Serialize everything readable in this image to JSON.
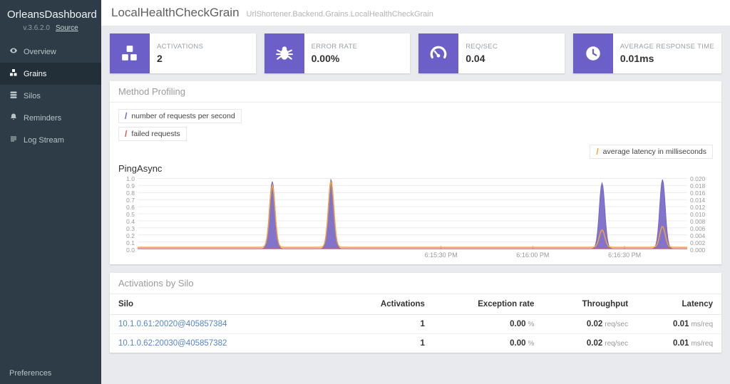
{
  "theme": {
    "accent": "#6c5fc7",
    "orange": "#f2a33c",
    "red": "#d9534f",
    "sidebar_bg": "#2d3c46"
  },
  "sidebar": {
    "brand": "OrleansDashboard",
    "version": "v.3.6.2.0",
    "source_link": "Source",
    "items": [
      {
        "label": "Overview",
        "icon": "overview-icon",
        "active": false
      },
      {
        "label": "Grains",
        "icon": "grains-icon",
        "active": true
      },
      {
        "label": "Silos",
        "icon": "silos-icon",
        "active": false
      },
      {
        "label": "Reminders",
        "icon": "reminders-icon",
        "active": false
      },
      {
        "label": "Log Stream",
        "icon": "log-stream-icon",
        "active": false
      }
    ],
    "preferences": "Preferences"
  },
  "header": {
    "title": "LocalHealthCheckGrain",
    "subtitle": "UrlShortener.Backend.Grains.LocalHealthCheckGrain"
  },
  "stats": {
    "cards": [
      {
        "label": "ACTIVATIONS",
        "value": "2",
        "icon": "cubes-icon"
      },
      {
        "label": "ERROR RATE",
        "value": "0.00%",
        "icon": "bug-icon"
      },
      {
        "label": "REQ/SEC",
        "value": "0.04",
        "icon": "gauge-icon"
      },
      {
        "label": "AVERAGE RESPONSE TIME",
        "value": "0.01ms",
        "icon": "clock-icon"
      }
    ]
  },
  "profiling": {
    "panel_title": "Method Profiling",
    "legend": [
      {
        "label": "number of requests per second",
        "color": "#6c5fc7"
      },
      {
        "label": "failed requests",
        "color": "#d9534f"
      },
      {
        "label": "average latency in milliseconds",
        "color": "#f2a33c"
      }
    ],
    "method_name": "PingAsync"
  },
  "chart_data": {
    "type": "area",
    "title": "PingAsync",
    "grid": true,
    "left_axis": {
      "min": 0,
      "max": 1.0,
      "labels": [
        "1.0",
        "0.9",
        "0.8",
        "0.7",
        "0.6",
        "0.5",
        "0.4",
        "0.3",
        "0.2",
        "0.1",
        "0.0"
      ]
    },
    "right_axis": {
      "min": 0,
      "max": 0.02,
      "labels": [
        "0.020",
        "0.018",
        "0.016",
        "0.014",
        "0.012",
        "0.010",
        "0.008",
        "0.006",
        "0.004",
        "0.002",
        "0.000"
      ]
    },
    "x_ticks": [
      {
        "pos": 0.552,
        "label": "6:15:30 PM"
      },
      {
        "pos": 0.719,
        "label": "6:16:00 PM"
      },
      {
        "pos": 0.886,
        "label": "6:16:30 PM"
      }
    ],
    "series": [
      {
        "name": "number of requests per second",
        "axis": "left",
        "color": "#7465c8",
        "baseline": 0,
        "spikes": [
          {
            "pos": 0.245,
            "peak": 0.97
          },
          {
            "pos": 0.352,
            "peak": 1.0
          },
          {
            "pos": 0.845,
            "peak": 0.95
          },
          {
            "pos": 0.955,
            "peak": 1.0
          }
        ]
      },
      {
        "name": "failed requests",
        "axis": "left",
        "color": "#d9534f",
        "baseline": 0,
        "spikes": []
      },
      {
        "name": "average latency in milliseconds",
        "axis": "right",
        "color": "#f2a33c",
        "baseline": 0.0004,
        "spikes": [
          {
            "pos": 0.245,
            "peak": 0.018
          },
          {
            "pos": 0.352,
            "peak": 0.019
          },
          {
            "pos": 0.845,
            "peak": 0.005
          },
          {
            "pos": 0.955,
            "peak": 0.006
          }
        ]
      }
    ]
  },
  "activations": {
    "panel_title": "Activations by Silo",
    "columns": [
      "Silo",
      "Activations",
      "Exception rate",
      "Throughput",
      "Latency"
    ],
    "rows": [
      {
        "silo": "10.1.0.61:20020@405857384",
        "activations": "1",
        "exception_rate": "0.00",
        "exception_unit": "%",
        "throughput": "0.02",
        "throughput_unit": "req/sec",
        "latency": "0.01",
        "latency_unit": "ms/req"
      },
      {
        "silo": "10.1.0.62:20030@405857382",
        "activations": "1",
        "exception_rate": "0.00",
        "exception_unit": "%",
        "throughput": "0.02",
        "throughput_unit": "req/sec",
        "latency": "0.01",
        "latency_unit": "ms/req"
      }
    ]
  }
}
